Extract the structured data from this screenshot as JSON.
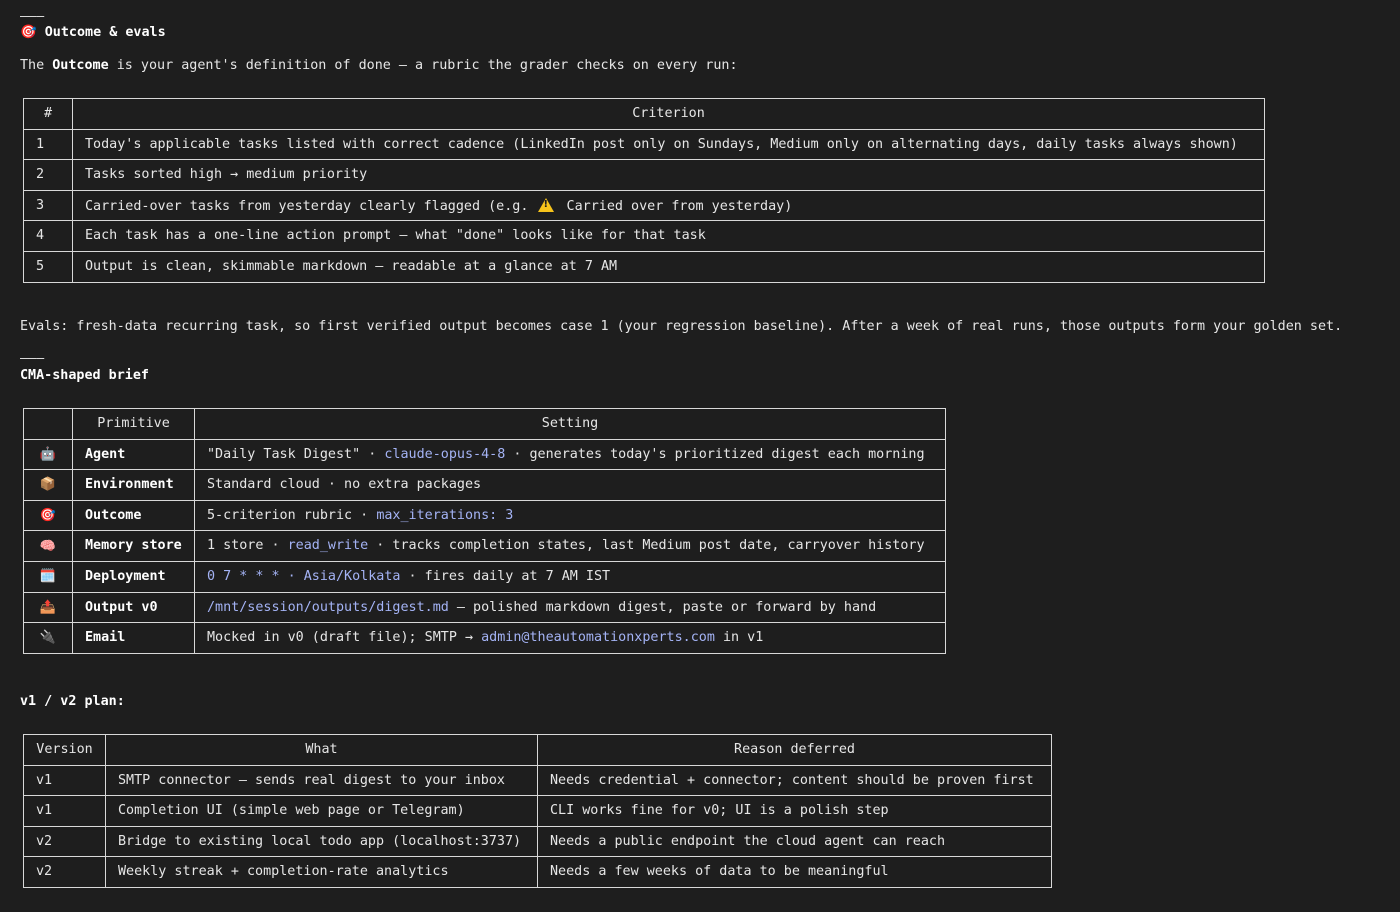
{
  "rule1": "———",
  "rule2": "———",
  "outcome_heading": {
    "icon": "🎯",
    "text": "Outcome & evals"
  },
  "outcome_intro": {
    "pre": "The ",
    "bold": "Outcome",
    "post": " is your agent's definition of done — a rubric the grader checks on every run:"
  },
  "criteria_table": {
    "headers": [
      "#",
      "Criterion"
    ],
    "rows": [
      {
        "num": "1",
        "text": "Today's applicable tasks listed with correct cadence (LinkedIn post only on Sundays, Medium only on alternating days, daily tasks always shown)"
      },
      {
        "num": "2",
        "text": "Tasks sorted high → medium priority"
      },
      {
        "num": "3",
        "text_pre": "Carried-over tasks from yesterday clearly flagged (e.g.",
        "text_post": "Carried over from yesterday)"
      },
      {
        "num": "4",
        "text": "Each task has a one-line action prompt — what \"done\" looks like for that task"
      },
      {
        "num": "5",
        "text": "Output is clean, skimmable markdown — readable at a glance at 7 AM"
      }
    ]
  },
  "evals_text": "Evals: fresh-data recurring task, so first verified output becomes case 1 (your regression baseline). After a week of real runs, those outputs form your golden set.",
  "brief_heading": "CMA-shaped brief",
  "brief_table": {
    "headers": [
      "",
      "Primitive",
      "Setting"
    ],
    "rows": [
      {
        "icon": "🤖",
        "icon_name": "robot-icon",
        "primitive": "Agent",
        "pre": "\"Daily Task Digest\" · ",
        "code": "claude-opus-4-8",
        "post": " · generates today's prioritized digest each morning"
      },
      {
        "icon": "📦",
        "icon_name": "package-icon",
        "primitive": "Environment",
        "pre": "Standard cloud · no extra packages",
        "code": "",
        "post": ""
      },
      {
        "icon": "🎯",
        "icon_name": "target-icon",
        "primitive": "Outcome",
        "pre": "5-criterion rubric · ",
        "code": "max_iterations: 3",
        "post": ""
      },
      {
        "icon": "🧠",
        "icon_name": "brain-icon",
        "primitive": "Memory store",
        "pre": "1 store · ",
        "code": "read_write",
        "post": " · tracks completion states, last Medium post date, carryover history"
      },
      {
        "icon": "🗓️",
        "icon_name": "calendar-icon",
        "primitive": "Deployment",
        "pre": "",
        "code": "0 7 * * * · Asia/Kolkata",
        "post": " · fires daily at 7 AM IST"
      },
      {
        "icon": "📤",
        "icon_name": "outbox-icon",
        "primitive": "Output v0",
        "pre": "",
        "code": "/mnt/session/outputs/digest.md",
        "post": " — polished markdown digest, paste or forward by hand"
      },
      {
        "icon": "🔌",
        "icon_name": "plug-icon",
        "primitive": "Email",
        "pre": "Mocked in v0 (draft file); SMTP → ",
        "code": "admin@theautomationxperts.com",
        "post": " in v1"
      }
    ]
  },
  "plan_heading": "v1 / v2 plan:",
  "plan_table": {
    "headers": [
      "Version",
      "What",
      "Reason deferred"
    ],
    "rows": [
      {
        "version": "v1",
        "what": "SMTP connector — sends real digest to your inbox",
        "reason": "Needs credential + connector; content should be proven first"
      },
      {
        "version": "v1",
        "what": "Completion UI (simple web page or Telegram)",
        "reason": "CLI works fine for v0; UI is a polish step"
      },
      {
        "version": "v2",
        "what": "Bridge to existing local todo app (localhost:3737)",
        "reason": "Needs a public endpoint the cloud agent can reach"
      },
      {
        "version": "v2",
        "what": "Weekly streak + completion-rate analytics",
        "reason": "Needs a few weeks of data to be meaningful"
      }
    ]
  },
  "colors": {
    "background": "#1e1e1e",
    "text": "#e6e6e6",
    "code": "#a4b3f5",
    "border": "#d8d8d8"
  }
}
